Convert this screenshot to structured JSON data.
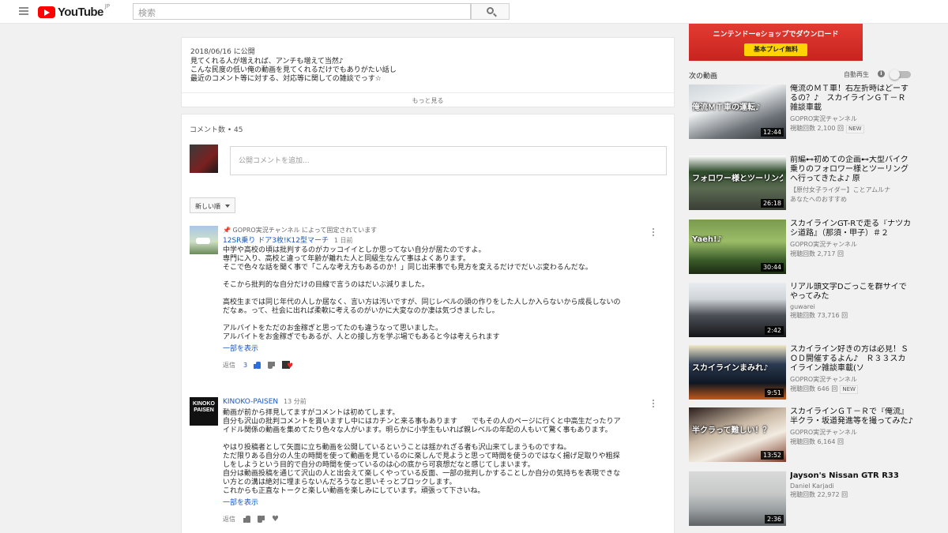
{
  "masthead": {
    "logo_text": "YouTube",
    "region": "JP",
    "search_placeholder": "検索"
  },
  "description": {
    "date": "2018/06/16 に公開",
    "lines": [
      "見てくれる人が増えれば、アンチも増えて当然♪",
      "こんな民度の低い俺の動画を見てくれるだけでもありがたい話し",
      "最近のコメント等に対する、対応等に関しての雑談でっす☆"
    ],
    "show_more": "もっと見る"
  },
  "comments": {
    "count_label": "コメント数 • 45",
    "add_placeholder": "公開コメントを追加...",
    "sort_label": "新しい順",
    "items": [
      {
        "pinned": "GOPRO実況チャンネル によって固定されています",
        "author": "12SR乗り ドア3枚!K12型マーチ",
        "time": "1 日前",
        "lines": [
          "中学や高校の頃は批判するのがカッコイイとしか思ってない自分が居たのですよ。",
          "専門に入り、高校と違って年齢が離れた人と同級生なんて事はよくあります。",
          "そこで色々な話を聞く事で「こんな考え方もあるのか！」同じ出来事でも見方を変えるだけでだいぶ変わるんだな。",
          "",
          "そこから批判的な自分だけの目線で言うのはだいぶ減りました。",
          "",
          "高校生までは同じ年代の人しか居なく、言い方は汚いですが、同じレベルの頭の作りをした人しか入らないから成長しないの",
          "だなぁ。って、社会に出れば柔軟に考えるのがいかに大変なのか凄は気づきましたし。",
          "",
          "アルバイトをただのお金稼ぎと思ってたのも違うなって思いました。",
          "アルバイトをお金稼ぎでもあるが、人との接し方を学ぶ場でもあると今は考えられます"
        ],
        "read_more": "一部を表示",
        "reply": "返信",
        "reply_count": "3"
      },
      {
        "avatar_text": "KINOKO PAISEN",
        "author": "KINOKO-PAISEN",
        "time": "13 分前",
        "lines": [
          "動画が前から拝見してますがコメントは初めてします。",
          "自分も沢山の批判コメントを貰いますし中にはカチンと来る事もあります　　でもその人のページに行くと中高生だったりア",
          "イドル関係の動画を集めてたり色々な人がいます。明らかに小学生もいれば親レベルの年配の人もいて驚く事もあります。",
          "",
          "やはり投稿者として矢面に立ち動画を公開しているということは揺かれざる者も沢山来てしまうものですね。",
          "ただ限りある自分の人生の時間を使って動画を見ているのに楽しんで見ようと思って時間を使うのではなく揚げ足取りや粗探",
          "しをしようという目的で自分の時間を使っているのは心の底から可哀想だなと感じてしまいます。",
          "自分は動画投稿を通じて沢山の人と出会えて楽しくやっている反面、一部の批判しかすることしか自分の気持ちを表現できな",
          "い方との溝は絶対に埋まらないんだろうなと思いそっとブロックします。",
          "これからも正直なトークと楽しい動画を楽しみにしています。頑張って下さいね。"
        ],
        "read_more": "一部を表示",
        "reply": "返信"
      }
    ]
  },
  "sidebar": {
    "ad": {
      "line1": "ニンテンドーeショップでダウンロード",
      "button": "基本プレイ無料"
    },
    "next_label": "次の動画",
    "autoplay_label": "自動再生",
    "videos": [
      {
        "title": "俺流のＭＴ車！右左折時はどーするの？♪　スカイラインＧＴ－Ｒ雑談車載",
        "channel": "GOPRO実況チャンネル",
        "views": "視聴回数 2,100 回",
        "badge": "NEW",
        "duration": "12:44",
        "thumb_caption": "俺流ＭＴ車の運転♪"
      },
      {
        "title": "前編⊷初めての企画⊷大型バイク乗りのフォロワー様とツーリングへ行ってきたよ♪ 原",
        "channel": "【原付女子ライダー】ことアムルナ",
        "views": "あなたへのおすすめ",
        "duration": "26:18",
        "thumb_caption": "フォロワー様とツーリング"
      },
      {
        "title": "スカイラインGT-Rで走る『ナツカシ道路』（那須・甲子）＃２",
        "channel": "GOPRO実況チャンネル",
        "views": "視聴回数 2,717 回",
        "duration": "30:44",
        "thumb_caption": "Yaeh!♪"
      },
      {
        "title": "リアル頭文字Dごっこを群サイでやってみた",
        "channel": "guwarei",
        "views": "視聴回数 73,716 回",
        "duration": "2:42",
        "thumb_caption": ""
      },
      {
        "title": "スカイライン好きの方は必見！ＳＯＤ開催するよん♪　Ｒ３３スカイライン雑談車載(ソ",
        "channel": "GOPRO実況チャンネル",
        "views": "視聴回数 646 回",
        "badge": "NEW",
        "duration": "9:51",
        "thumb_caption": "スカイラインまみれ♪"
      },
      {
        "title": "スカイラインＧＴ－Ｒで『俺流』半クラ・坂道発進等を撮ってみた♪",
        "channel": "GOPRO実況チャンネル",
        "views": "視聴回数 6,164 回",
        "duration": "13:52",
        "thumb_caption": "半クラって難しい！？"
      },
      {
        "title": "Jayson's Nissan GTR R33",
        "channel": "Daniel Karjadi",
        "views": "視聴回数 22,972 回",
        "duration": "2:36",
        "thumb_caption": ""
      }
    ]
  }
}
